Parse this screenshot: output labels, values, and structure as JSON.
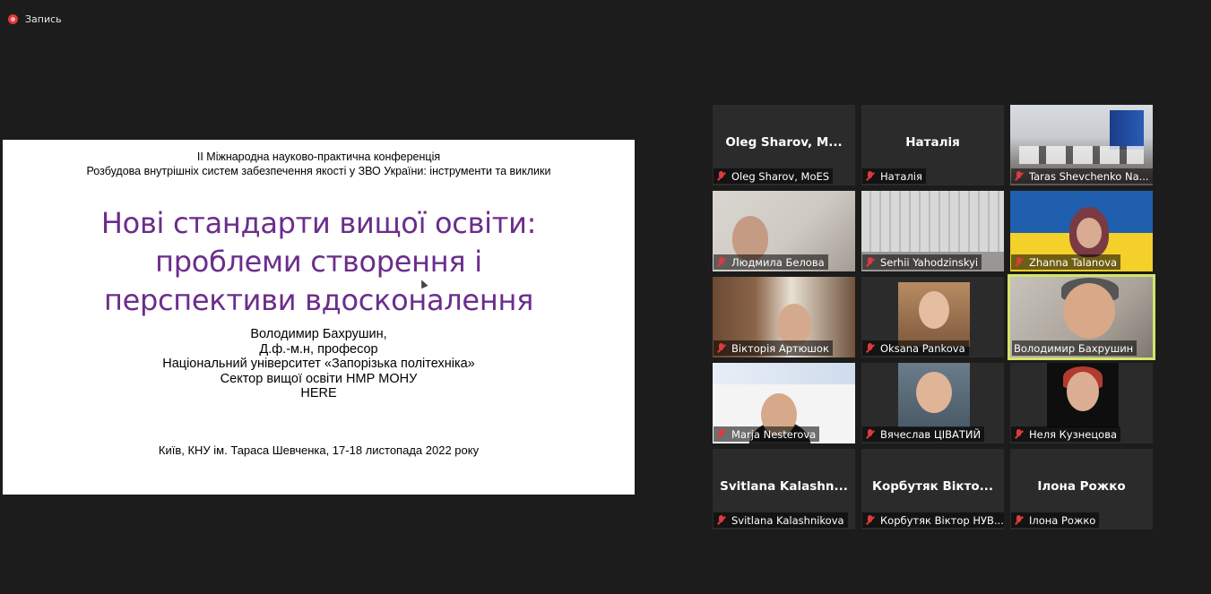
{
  "recording": {
    "label": "Запись",
    "indicator_color": "#e0393e"
  },
  "slide": {
    "conference_line1": "II Міжнародна науково-практична конференція",
    "conference_line2": "Розбудова внутрішніх систем забезпечення якості у ЗВО України: інструменти та виклики",
    "title_line1": "Нові стандарти вищої освіти:",
    "title_line2": "проблеми створення і",
    "title_line3": "перспективи вдосконалення",
    "title_color": "#6b2d8c",
    "author_name": "Володимир Бахрушин,",
    "author_degree": "Д.ф.-м.н, професор",
    "author_university": "Національний університет «Запорізька політехніка»",
    "author_sector": "Сектор вищої освіти НМР МОНУ",
    "author_extra": "HERE",
    "place_date": "Київ, КНУ ім. Тараса Шевченка, 17-18 листопада 2022 року"
  },
  "participants": [
    {
      "big_name": "Oleg  Sharov,  M...",
      "label": "Oleg Sharov, MoES",
      "video": false,
      "muted": true
    },
    {
      "big_name": "Наталія",
      "label": "Наталія",
      "video": false,
      "muted": true
    },
    {
      "label": "Taras Shevchenko Na...",
      "video": true,
      "muted": true
    },
    {
      "label": "Людмила Белова",
      "video": true,
      "muted": true
    },
    {
      "label": "Serhii Yahodzinskyi",
      "video": true,
      "muted": true
    },
    {
      "label": "Zhanna Talanova",
      "video": true,
      "muted": true
    },
    {
      "label": "Вікторія Артюшок",
      "video": true,
      "muted": true
    },
    {
      "label": "Oksana Pankova",
      "video": true,
      "muted": true
    },
    {
      "label": "Володимир Бахрушин",
      "video": true,
      "muted": false,
      "active_speaker": true,
      "highlight_color": "#d5e46a"
    },
    {
      "label": "Marja Nesterova",
      "video": true,
      "muted": true
    },
    {
      "label": "Вячеслав ЦІВАТИЙ",
      "video": true,
      "muted": true
    },
    {
      "label": "Неля Кузнецова",
      "video": true,
      "muted": true
    },
    {
      "big_name": "Svitlana  Kalashn...",
      "label": "Svitlana Kalashnikova",
      "video": false,
      "muted": true
    },
    {
      "big_name": "Корбутяк  Вікто...",
      "label": "Корбутяк Віктор НУВ...",
      "video": false,
      "muted": true
    },
    {
      "big_name": "Ілона Рожко",
      "label": "Ілона Рожко",
      "video": false,
      "muted": true
    }
  ]
}
